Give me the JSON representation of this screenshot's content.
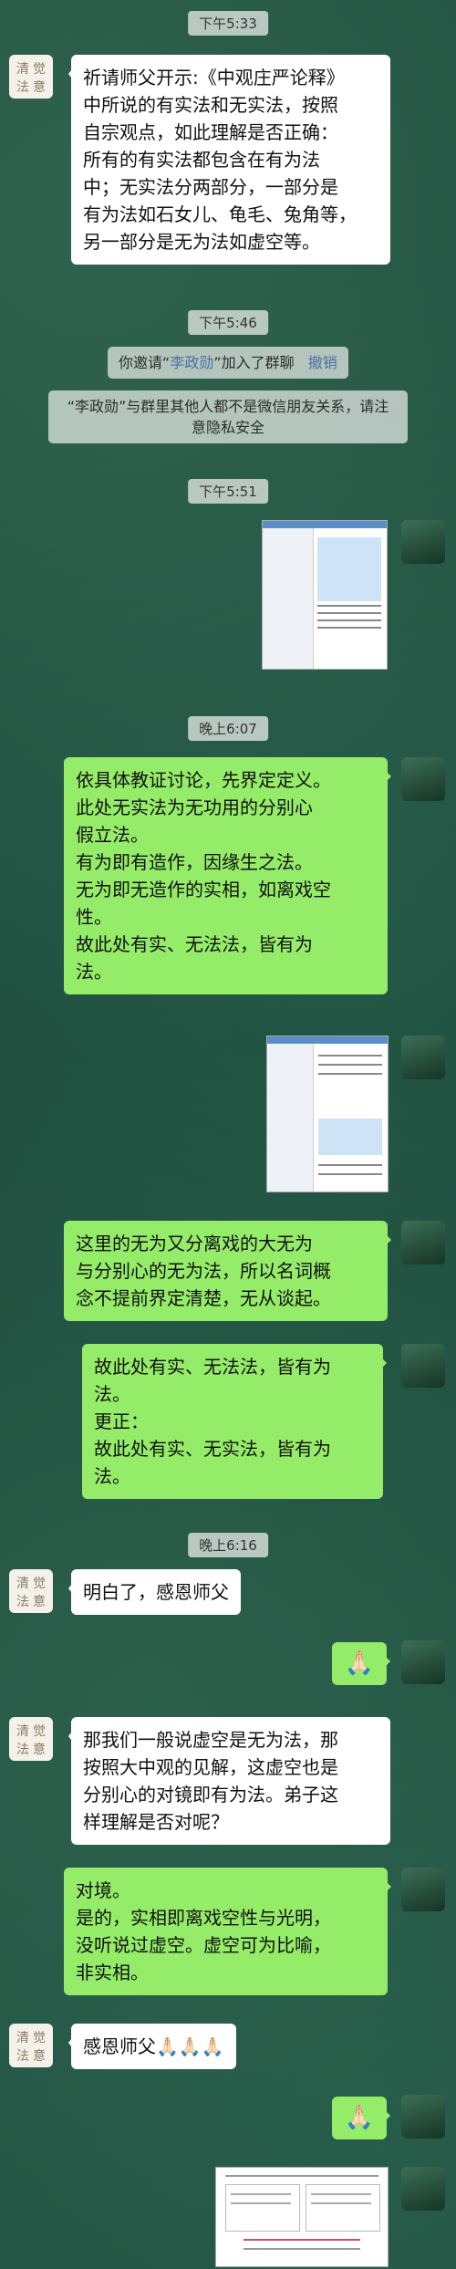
{
  "timestamps": [
    "下午5:33",
    "下午5:46",
    "下午5:51",
    "晚上6:07",
    "晚上6:16"
  ],
  "system": {
    "invite_prefix": "你邀请“",
    "invite_name": "李政勋",
    "invite_suffix": "”加入了群聊",
    "revoke": "撤销",
    "notice_line1": "“李政勋”与群里其他人都不是微信朋友关系，请注",
    "notice_line2": "意隐私安全"
  },
  "avatar_left": {
    "chars": [
      "清",
      "觉",
      "法",
      "意"
    ]
  },
  "messages": {
    "m1": [
      "祈请师父开示:《中观庄严论释》",
      "中所说的有实法和无实法，按照",
      "自宗观点，如此理解是否正确：",
      "所有的有实法都包含在有为法",
      "中；无实法分两部分，一部分是",
      "有为法如石女儿、龟毛、兔角等，",
      "另一部分是无为法如虚空等。"
    ],
    "m2": [
      "依具体教证讨论，先界定定义。",
      "此处无实法为无功用的分别心",
      "假立法。",
      "有为即有造作，因缘生之法。",
      "无为即无造作的实相，如离戏空",
      "性。",
      "故此处有实、无法法，皆有为",
      "法。"
    ],
    "m3": [
      "这里的无为又分离戏的大无为",
      "与分别心的无为法，所以名词概",
      "念不提前界定清楚，无从谈起。"
    ],
    "m4": [
      "故此处有实、无法法，皆有为",
      "法。",
      "更正：",
      "故此处有实、无实法，皆有为",
      "法。"
    ],
    "m5": [
      "明白了，感恩师父"
    ],
    "m6": [
      "🙏🏻"
    ],
    "m7": [
      "那我们一般说虚空是无为法，那",
      "按照大中观的见解，这虚空也是",
      "分别心的对镜即有为法。弟子这",
      "样理解是否对呢？"
    ],
    "m8": [
      "对境。",
      "是的，实相即离戏空性与光明，",
      "没听说过虚空。虚空可为比喻，",
      "非实相。"
    ],
    "m9": [
      "感恩师父🙏🏻🙏🏻🙏🏻"
    ],
    "m10": [
      "🙏🏻"
    ]
  },
  "colors": {
    "sent_bubble": "#95ec69",
    "received_bubble": "#ffffff",
    "link": "#4a6fa3"
  }
}
